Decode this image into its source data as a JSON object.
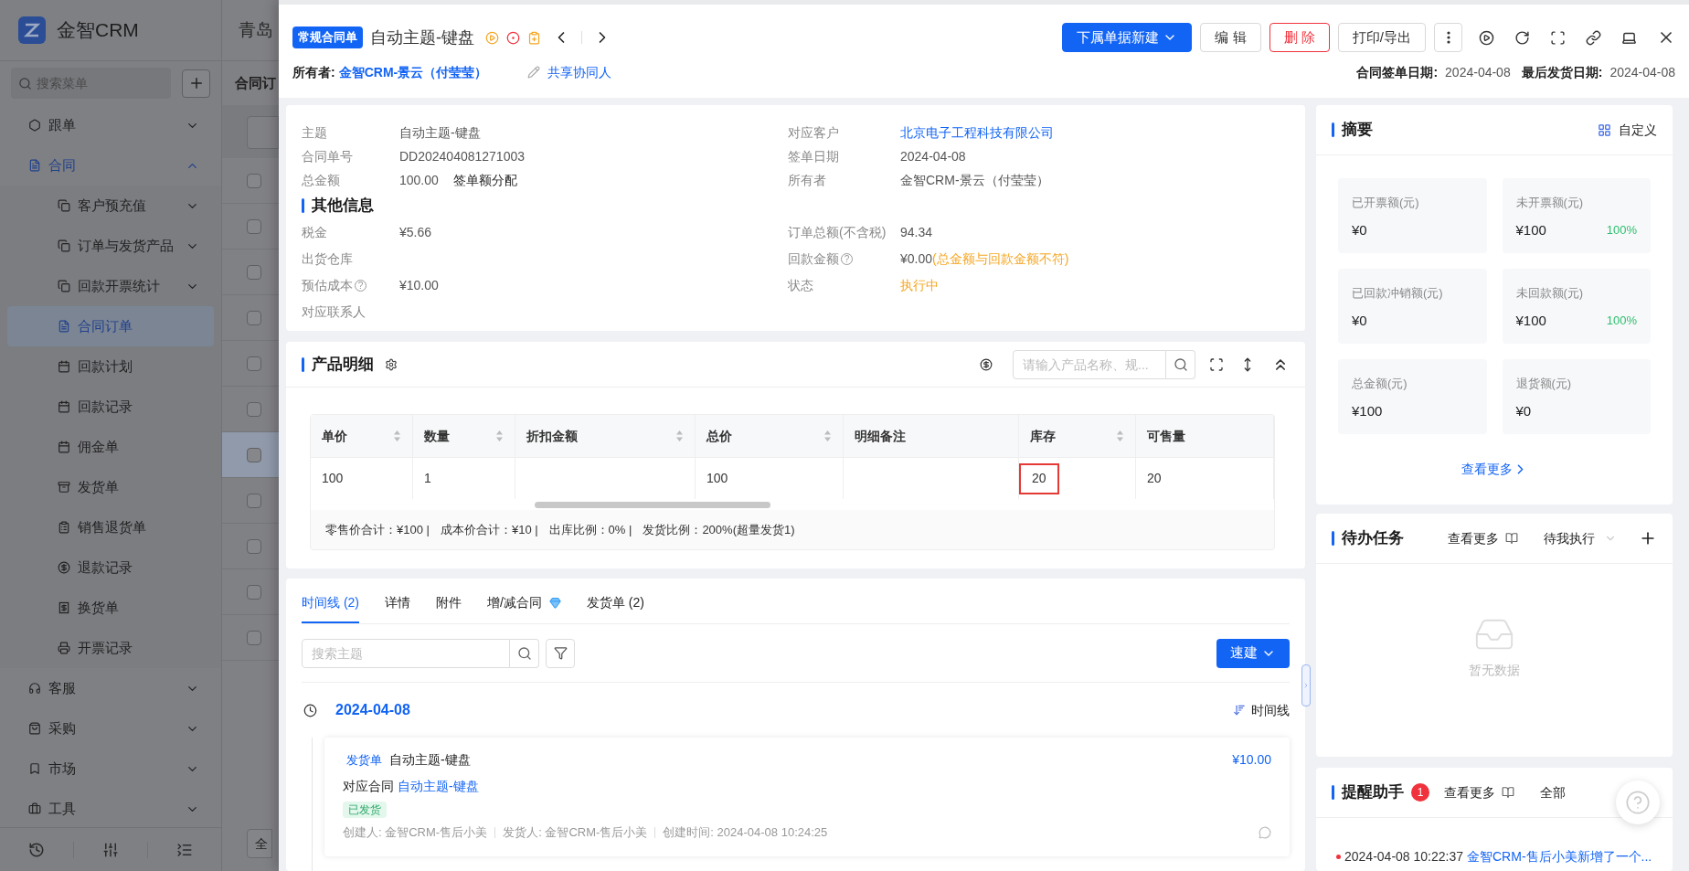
{
  "sidebar": {
    "logo_text": "金智CRM",
    "search": {
      "placeholder": "搜索菜单"
    },
    "items": [
      {
        "label": "跟单",
        "kind": "group",
        "expanded": false,
        "selected": false
      },
      {
        "label": "合同",
        "kind": "group",
        "expanded": true,
        "selected": false,
        "children": [
          {
            "label": "客户预充值",
            "kind": "group",
            "expanded": false,
            "selected": false
          },
          {
            "label": "订单与发货产品",
            "kind": "group",
            "expanded": false,
            "selected": false
          },
          {
            "label": "回款开票统计",
            "kind": "group",
            "expanded": false,
            "selected": false
          },
          {
            "label": "合同订单",
            "kind": "page",
            "selected": true
          },
          {
            "label": "回款计划",
            "kind": "page",
            "selected": false
          },
          {
            "label": "回款记录",
            "kind": "page",
            "selected": false
          },
          {
            "label": "佣金单",
            "kind": "page",
            "selected": false
          },
          {
            "label": "发货单",
            "kind": "page",
            "selected": false
          },
          {
            "label": "销售退货单",
            "kind": "page",
            "selected": false
          },
          {
            "label": "退款记录",
            "kind": "page",
            "selected": false
          },
          {
            "label": "换货单",
            "kind": "page",
            "selected": false
          },
          {
            "label": "开票记录",
            "kind": "page",
            "selected": false
          }
        ]
      },
      {
        "label": "客服",
        "kind": "group",
        "expanded": false,
        "selected": false
      },
      {
        "label": "采购",
        "kind": "group",
        "expanded": false,
        "selected": false
      },
      {
        "label": "市场",
        "kind": "group",
        "expanded": false,
        "selected": false
      },
      {
        "label": "工具",
        "kind": "group",
        "expanded": false,
        "selected": false
      }
    ]
  },
  "background_page": {
    "header_title": "青岛",
    "page_title": "合同订",
    "rows": [
      {
        "checked": false,
        "selected": false
      },
      {
        "checked": false,
        "selected": false
      },
      {
        "checked": false,
        "selected": false
      },
      {
        "checked": false,
        "selected": false
      },
      {
        "checked": false,
        "selected": false
      },
      {
        "checked": false,
        "selected": false
      },
      {
        "checked": false,
        "selected": true
      },
      {
        "checked": false,
        "selected": false
      },
      {
        "checked": false,
        "selected": false
      },
      {
        "checked": false,
        "selected": false
      },
      {
        "checked": false,
        "selected": false
      }
    ],
    "footer_button": "全"
  },
  "drawer": {
    "header": {
      "badge": "常规合同单",
      "title": "自动主题-键盘",
      "owner_label": "所有者:",
      "owner": "金智CRM-景云（付莹莹）",
      "share": "共享协同人",
      "actions": [
        {
          "label": "下属单据新建",
          "kind": "primary"
        },
        {
          "label": "编 辑",
          "kind": "default"
        },
        {
          "label": "删 除",
          "kind": "danger"
        },
        {
          "label": "打印/导出",
          "kind": "default"
        }
      ],
      "dates": [
        {
          "label": "合同签单日期:",
          "value": "2024-04-08"
        },
        {
          "label": "最后发货日期:",
          "value": "2024-04-08"
        }
      ]
    },
    "info": {
      "main_left": [
        {
          "label": "主题",
          "value": "自动主题-键盘",
          "kind": "text"
        },
        {
          "label": "合同单号",
          "value": "DD202404081271003",
          "kind": "text"
        },
        {
          "label": "总金额",
          "value": "100.00",
          "extra": "签单额分配",
          "kind": "text"
        }
      ],
      "main_right": [
        {
          "label": "对应客户",
          "value": "北京电子工程科技有限公司",
          "kind": "link"
        },
        {
          "label": "签单日期",
          "value": "2024-04-08",
          "kind": "text"
        },
        {
          "label": "所有者",
          "value": "金智CRM-景云（付莹莹）",
          "kind": "text"
        }
      ],
      "section_title": "其他信息",
      "other_left": [
        {
          "label": "税金",
          "value": "¥5.66",
          "kind": "text"
        },
        {
          "label": "出货仓库",
          "kind": "text"
        },
        {
          "label": "预估成本",
          "value": "¥10.00",
          "help_mark": "?",
          "kind": "text"
        },
        {
          "label": "对应联系人",
          "kind": "text"
        }
      ],
      "other_right": [
        {
          "label": "订单总额(不含税)",
          "value": "94.34",
          "kind": "text"
        },
        {
          "label": "回款金额",
          "value": "¥0.00",
          "note": "(总金额与回款金额不符)",
          "help_mark": "?",
          "kind": "text"
        },
        {
          "label": "状态",
          "value": "执行中",
          "kind": "status"
        }
      ]
    },
    "products": {
      "title": "产品明细",
      "search": {
        "placeholder": "请输入产品名称、规..."
      },
      "columns": [
        {
          "label": "单价",
          "sortable": true
        },
        {
          "label": "数量",
          "sortable": true
        },
        {
          "label": "折扣金额",
          "sortable": true
        },
        {
          "label": "总价",
          "sortable": true
        },
        {
          "label": "明细备注",
          "sortable": false
        },
        {
          "label": "库存",
          "sortable": true
        },
        {
          "label": "可售量",
          "sortable": false
        }
      ],
      "rows": [
        {
          "cells": [
            {
              "text": "100",
              "highlighted": false
            },
            {
              "text": "1",
              "highlighted": false
            },
            {
              "highlighted": false
            },
            {
              "text": "100",
              "highlighted": false
            },
            {
              "highlighted": false
            },
            {
              "text": "20",
              "highlighted": true
            },
            {
              "text": "20",
              "highlighted": false
            }
          ]
        }
      ],
      "footer": [
        "零售价合计：¥100 |",
        "成本价合计：¥10 |",
        "出库比例：0% |",
        "发货比例：200%(超量发货1)"
      ]
    },
    "activity": {
      "tabs": [
        {
          "label": "时间线 (2)",
          "selected": true,
          "kind": "plain"
        },
        {
          "label": "详情",
          "selected": false,
          "kind": "plain"
        },
        {
          "label": "附件",
          "selected": false,
          "kind": "plain"
        },
        {
          "label": "增/减合同",
          "selected": false,
          "kind": "premium"
        },
        {
          "label": "发货单 (2)",
          "selected": false,
          "kind": "plain"
        }
      ],
      "search": {
        "placeholder": "搜索主题"
      },
      "quick_button": "速建",
      "date": "2024-04-08",
      "sort_label": "时间线",
      "entries": [
        {
          "tag": "发货单",
          "title": "自动主题-键盘",
          "amount": "¥10.00",
          "relation_label": "对应合同",
          "relation_link": "自动主题-键盘",
          "status": "已发货",
          "meta": [
            "创建人: 金智CRM-售后小美",
            "发货人: 金智CRM-售后小美",
            "创建时间: 2024-04-08 10:24:25"
          ]
        }
      ]
    },
    "summary": {
      "title": "摘要",
      "customize": "自定义",
      "stats": [
        {
          "label": "已开票额(元)",
          "value": "¥0"
        },
        {
          "label": "未开票额(元)",
          "value": "¥100",
          "percent": "100%"
        },
        {
          "label": "已回款冲销额(元)",
          "value": "¥0"
        },
        {
          "label": "未回款额(元)",
          "value": "¥100",
          "percent": "100%"
        },
        {
          "label": "总金额(元)",
          "value": "¥100"
        },
        {
          "label": "退货额(元)",
          "value": "¥0"
        }
      ],
      "more": "查看更多"
    },
    "tasks": {
      "title": "待办任务",
      "more": "查看更多",
      "filter": "待我执行",
      "empty": "暂无数据"
    },
    "reminders": {
      "title": "提醒助手",
      "count": "1",
      "more": "查看更多",
      "filter": "全部",
      "items": [
        {
          "time": "2024-04-08 10:22:37",
          "text": "金智CRM-售后小美新增了一个..."
        }
      ]
    }
  }
}
